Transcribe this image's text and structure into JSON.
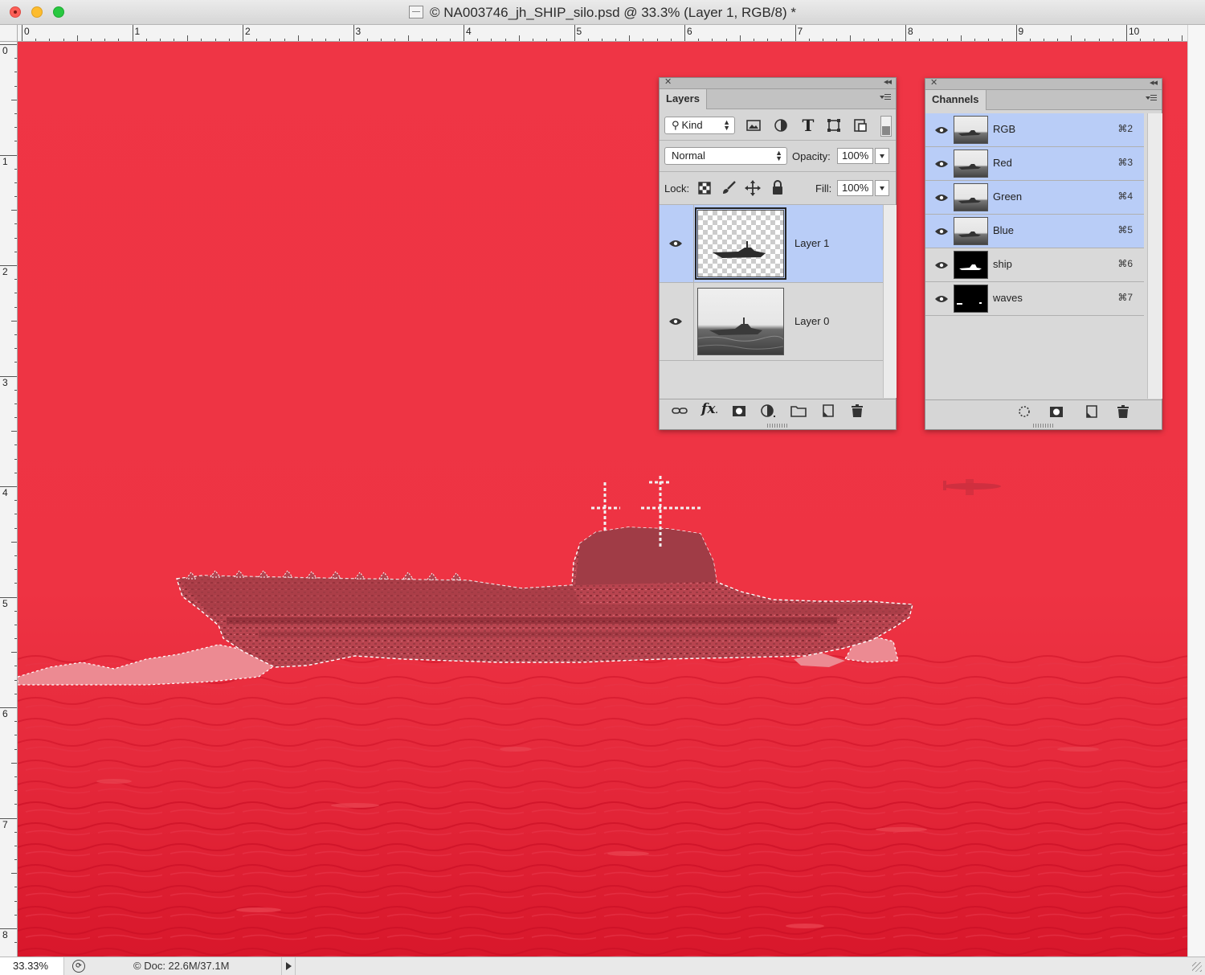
{
  "window": {
    "title": "© NA003746_jh_SHIP_silo.psd @ 33.3% (Layer 1, RGB/8) *"
  },
  "rulers": {
    "horizontal": [
      "0",
      "1",
      "2",
      "3",
      "4",
      "5",
      "6",
      "7",
      "8",
      "9",
      "10"
    ],
    "vertical": [
      "0",
      "1",
      "2",
      "3",
      "4",
      "5",
      "6",
      "7",
      "8"
    ]
  },
  "colors": {
    "quick_mask_overlay": "#ee3444",
    "selection_highlight": "#b9cdf7",
    "panel_bg": "#d6d6d6"
  },
  "layers_panel": {
    "tab": "Layers",
    "filter_label": "Kind",
    "blend_mode": "Normal",
    "opacity_label": "Opacity:",
    "opacity_value": "100%",
    "lock_label": "Lock:",
    "fill_label": "Fill:",
    "fill_value": "100%",
    "filter_icons": [
      "image-filter-icon",
      "adjustment-filter-icon",
      "type-filter-icon",
      "shape-filter-icon",
      "smart-object-filter-icon"
    ],
    "lock_icons": [
      "lock-transparency-icon",
      "lock-paint-icon",
      "lock-position-icon",
      "lock-all-icon"
    ],
    "layers": [
      {
        "name": "Layer 1",
        "selected": true,
        "visible": true,
        "thumbnail": "transparent-ship"
      },
      {
        "name": "Layer 0",
        "selected": false,
        "visible": true,
        "thumbnail": "ship-photo"
      }
    ],
    "footer_icons": [
      "link-layers-icon",
      "fx-icon",
      "add-mask-icon",
      "adjustment-layer-icon",
      "new-group-icon",
      "new-layer-icon",
      "trash-icon"
    ]
  },
  "channels_panel": {
    "tab": "Channels",
    "channels": [
      {
        "name": "RGB",
        "shortcut": "⌘2",
        "selected": true,
        "visible": true,
        "thumbnail": "photo"
      },
      {
        "name": "Red",
        "shortcut": "⌘3",
        "selected": true,
        "visible": true,
        "thumbnail": "photo"
      },
      {
        "name": "Green",
        "shortcut": "⌘4",
        "selected": true,
        "visible": true,
        "thumbnail": "photo"
      },
      {
        "name": "Blue",
        "shortcut": "⌘5",
        "selected": true,
        "visible": true,
        "thumbnail": "photo"
      },
      {
        "name": "ship",
        "shortcut": "⌘6",
        "selected": false,
        "visible": true,
        "thumbnail": "ship-mask"
      },
      {
        "name": "waves",
        "shortcut": "⌘7",
        "selected": false,
        "visible": true,
        "thumbnail": "waves-mask"
      }
    ],
    "footer_icons": [
      "load-selection-icon",
      "save-selection-icon",
      "new-channel-icon",
      "trash-icon"
    ]
  },
  "status": {
    "zoom": "33.33%",
    "doc_info": "Doc: 22.6M/37.1M"
  }
}
